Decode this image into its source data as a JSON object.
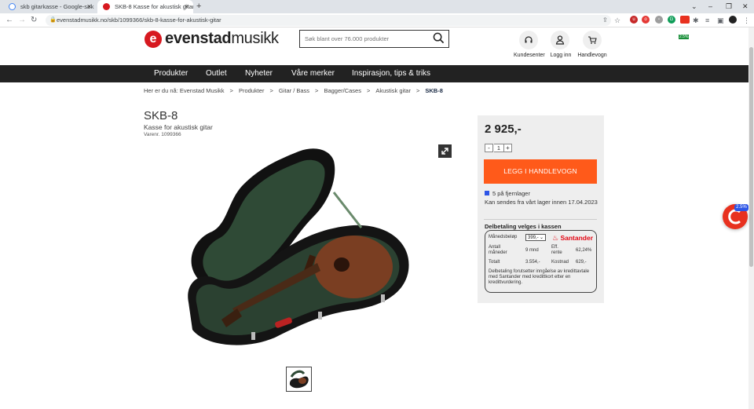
{
  "browser": {
    "tabs": [
      {
        "title": "skb gitarkasse - Google-søk"
      },
      {
        "title": "SKB-8 Kasse for akustisk gitar - E"
      }
    ],
    "url": "evenstadmusikk.no/skb/1099366/skb-8-kasse-for-akustisk-gitar",
    "ext_badge": "2.5%"
  },
  "site": {
    "logo_letter": "e",
    "logo_part1": "evenstad",
    "logo_part2": "musikk",
    "search_placeholder": "Søk blant over 76.000 produkter",
    "header_links": [
      {
        "label": "Kundesenter"
      },
      {
        "label": "Logg inn"
      },
      {
        "label": "Handlevogn"
      }
    ],
    "nav": [
      "Produkter",
      "Outlet",
      "Nyheter",
      "Våre merker",
      "Inspirasjon, tips & triks"
    ]
  },
  "breadcrumb": {
    "prefix": "Her er du nå: Evenstad Musikk",
    "items": [
      "Produkter",
      "Gitar / Bass",
      "Bagger/Cases",
      "Akustisk gitar"
    ],
    "current": "SKB-8"
  },
  "product": {
    "title": "SKB-8",
    "subtitle": "Kasse for akustisk gitar",
    "sku": "Varenr. 1099366",
    "price": "2 925,-",
    "quantity": "1",
    "qty_minus": "-",
    "qty_plus": "+",
    "buy_label": "LEGG I HANDLEVOGN",
    "stock": "5 på fjernlager",
    "shipping": "Kan sendes fra vårt lager innen 17.04.2023",
    "colors": {
      "buy": "#ff5a1a",
      "stock": "#2d55e6",
      "brand": "#d71920"
    }
  },
  "financing": {
    "title": "Delbetaling velges i kassen",
    "monthly_label": "Månedsbeløp",
    "monthly_value": "399,-",
    "provider": "Santander",
    "months_label": "Antall måneder",
    "months_value": "9 mnd",
    "rate_label": "Eff. rente",
    "rate_value": "62,24%",
    "total_label": "Totalt",
    "total_value": "3.554,-",
    "cost_label": "Kostnad",
    "cost_value": "629,-",
    "disclaimer": "Delbetaling forutsetter inngåelse av kredittavtale med Santander med kredittkort etter en kredittvurdering."
  },
  "widget": {
    "badge": "2.5%"
  }
}
